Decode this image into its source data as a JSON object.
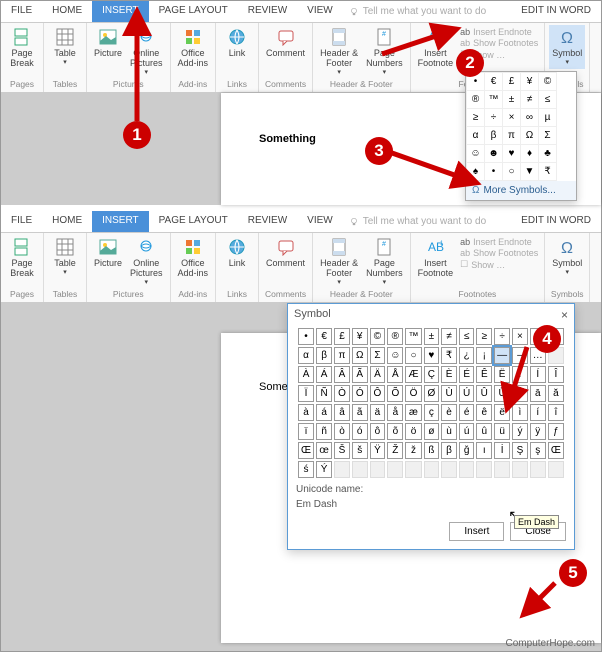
{
  "tabs": {
    "file": "FILE",
    "home": "HOME",
    "insert": "INSERT",
    "layout": "PAGE LAYOUT",
    "review": "REVIEW",
    "view": "VIEW",
    "tell": "Tell me what you want to do",
    "edit": "EDIT IN WORD"
  },
  "ribbon": {
    "pagebreak": "Page\nBreak",
    "pages": "Pages",
    "table": "Table",
    "tables": "Tables",
    "picture": "Picture",
    "online": "Online\nPictures",
    "pictures": "Pictures",
    "addins": "Office\nAdd-ins",
    "addinsg": "Add-ins",
    "link": "Link",
    "links": "Links",
    "comment": "Comment",
    "comments": "Comments",
    "header": "Header &\nFooter",
    "pagenum": "Page\nNumbers",
    "hf": "Header & Footer",
    "footnote": "Insert\nFootnote",
    "endnote": "Insert Endnote",
    "showfn": "Show Footnotes",
    "showep": "Show …",
    "footnotes": "Footnotes",
    "symbol": "Symbol",
    "symbols": "Symbols"
  },
  "doc": {
    "text1": "Something",
    "text2": "Something—",
    "cursor": "|"
  },
  "popup": {
    "grid": [
      [
        "•",
        "€",
        "£",
        "¥",
        "©"
      ],
      [
        "®",
        "™",
        "±",
        "≠",
        "≤"
      ],
      [
        "≥",
        "÷",
        "×",
        "∞",
        "µ"
      ],
      [
        "α",
        "β",
        "π",
        "Ω",
        "Σ"
      ],
      [
        "☺",
        "☻",
        "♥",
        "♦",
        "♣"
      ],
      [
        "♠",
        "•",
        "○",
        "▼",
        "₹"
      ]
    ],
    "more": "More Symbols..."
  },
  "dialog": {
    "title": "Symbol",
    "close": "×",
    "grid": [
      [
        "•",
        "€",
        "£",
        "¥",
        "©",
        "®",
        "™",
        "±",
        "≠",
        "≤",
        "≥",
        "÷",
        "×",
        "∞",
        "µ"
      ],
      [
        "α",
        "β",
        "π",
        "Ω",
        "Σ",
        "☺",
        "○",
        "♥",
        "₹",
        "¿",
        "¡",
        "—",
        "–",
        "…",
        ""
      ],
      [
        "À",
        "Á",
        "Â",
        "Ã",
        "Ä",
        "Å",
        "Æ",
        "Ç",
        "È",
        "É",
        "Ê",
        "Ë",
        "Ì",
        "Í",
        "Î"
      ],
      [
        "Ï",
        "Ñ",
        "Ò",
        "Ó",
        "Ô",
        "Õ",
        "Ö",
        "Ø",
        "Ù",
        "Ú",
        "Û",
        "Ü",
        "Ý",
        "ā",
        "ă"
      ],
      [
        "à",
        "á",
        "â",
        "ã",
        "ä",
        "å",
        "æ",
        "ç",
        "è",
        "é",
        "ê",
        "ë",
        "ì",
        "í",
        "î"
      ],
      [
        "ï",
        "ñ",
        "ò",
        "ó",
        "ô",
        "õ",
        "ö",
        "ø",
        "ù",
        "ú",
        "û",
        "ü",
        "ý",
        "ÿ",
        "ƒ"
      ],
      [
        "Œ",
        "œ",
        "Š",
        "š",
        "Ÿ",
        "Ž",
        "ž",
        "ß",
        "β",
        "ğ",
        "ı",
        "İ",
        "Ş",
        "ş",
        "Œ"
      ],
      [
        "ś",
        "Ý",
        "",
        "",
        "",
        "",
        "",
        "",
        "",
        "",
        "",
        "",
        "",
        "",
        ""
      ]
    ],
    "unamelbl": "Unicode name:",
    "uname": "Em Dash",
    "tooltip": "Em Dash",
    "insert": "Insert",
    "closeb": "Close"
  },
  "callouts": {
    "1": "1",
    "2": "2",
    "3": "3",
    "4": "4",
    "5": "5"
  },
  "footer": "ComputerHope.com"
}
